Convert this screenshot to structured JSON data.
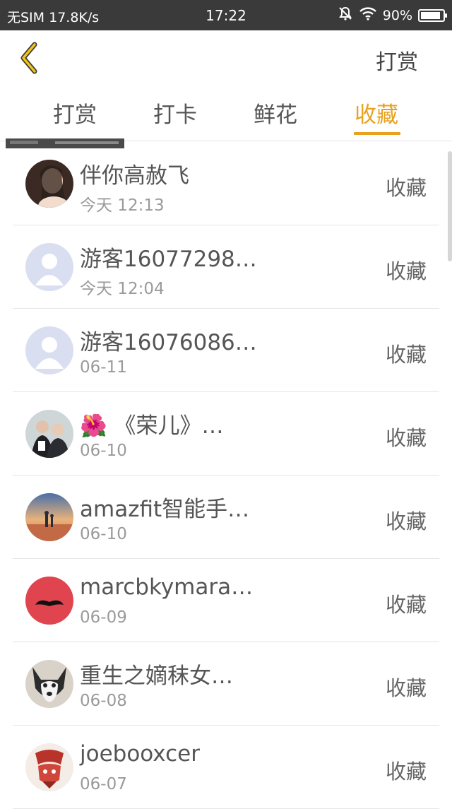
{
  "statusbar": {
    "carrier": "无SIM",
    "speed": "17.8K/s",
    "time": "17:22",
    "battery": "90%",
    "battery_level": 0.9
  },
  "header": {
    "back_icon": "chevron-left-icon",
    "action_label": "打赏",
    "accent_color": "#e8a21f"
  },
  "tabs": [
    {
      "label": "打赏",
      "active": false
    },
    {
      "label": "打卡",
      "active": false
    },
    {
      "label": "鲜花",
      "active": false
    },
    {
      "label": "收藏",
      "active": true
    }
  ],
  "list": [
    {
      "name": "伴你高赦飞",
      "time": "今天 12:13",
      "action": "收藏",
      "avatar": "photo-avatar-woman"
    },
    {
      "name": "游客16077298…",
      "time": "今天 12:04",
      "action": "收藏",
      "avatar": "default-guest-avatar"
    },
    {
      "name": "游客16076086…",
      "time": "06-11",
      "action": "收藏",
      "avatar": "default-guest-avatar"
    },
    {
      "name": "🌺 《荣儿》…",
      "time": "06-10",
      "action": "收藏",
      "avatar": "photo-avatar-couple"
    },
    {
      "name": "amazfit智能手…",
      "time": "06-10",
      "action": "收藏",
      "avatar": "photo-avatar-sunset"
    },
    {
      "name": "marcbkymara…",
      "time": "06-09",
      "action": "收藏",
      "avatar": "mustache-avatar"
    },
    {
      "name": "重生之嫡秣女…",
      "time": "06-08",
      "action": "收藏",
      "avatar": "photo-avatar-dog"
    },
    {
      "name": "joebooxcer",
      "time": "06-07",
      "action": "收藏",
      "avatar": "photo-avatar-red-pattern"
    }
  ]
}
